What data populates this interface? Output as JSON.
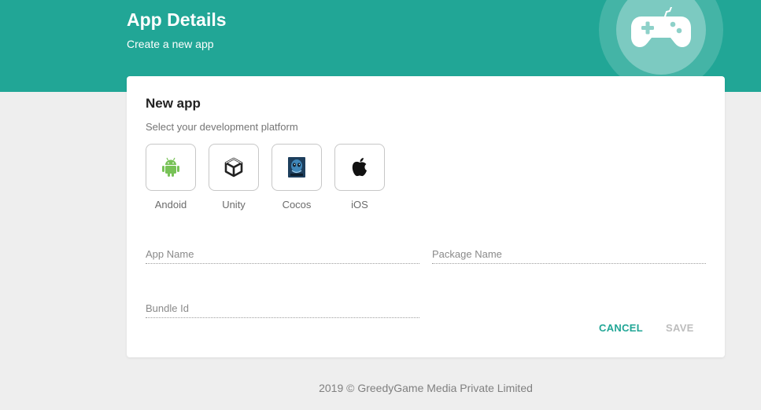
{
  "header": {
    "title": "App Details",
    "subtitle": "Create a new app",
    "badge_icon": "gamepad-icon",
    "color": "#21a696"
  },
  "card": {
    "title": "New app",
    "subtitle": "Select your development platform",
    "platforms": [
      {
        "label": "Andoid",
        "icon": "android-icon",
        "color": "#78c257"
      },
      {
        "label": "Unity",
        "icon": "unity-icon",
        "color": "#222222"
      },
      {
        "label": "Cocos",
        "icon": "cocos-icon",
        "color": "#1d3e5c"
      },
      {
        "label": "iOS",
        "icon": "apple-icon",
        "color": "#111111"
      }
    ],
    "fields": {
      "app_name": {
        "placeholder": "App Name",
        "value": ""
      },
      "package_name": {
        "placeholder": "Package Name",
        "value": ""
      },
      "bundle_id": {
        "placeholder": "Bundle Id",
        "value": ""
      }
    },
    "actions": {
      "cancel_label": "CANCEL",
      "save_label": "SAVE"
    }
  },
  "footer": {
    "text": "2019 © GreedyGame Media Private Limited"
  }
}
